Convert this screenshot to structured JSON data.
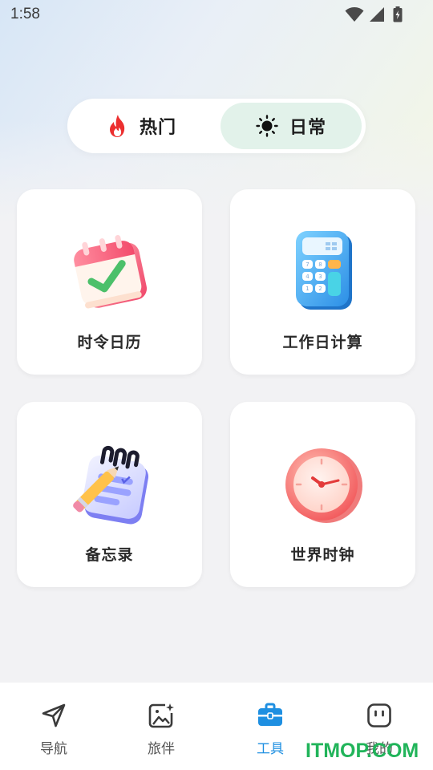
{
  "status": {
    "time": "1:58"
  },
  "segment": {
    "tabs": [
      {
        "label": "热门",
        "icon": "flame-icon",
        "selected": false
      },
      {
        "label": "日常",
        "icon": "sun-icon",
        "selected": true
      }
    ]
  },
  "tools": [
    {
      "label": "时令日历",
      "icon": "calendar-icon"
    },
    {
      "label": "工作日计算",
      "icon": "calculator-icon"
    },
    {
      "label": "备忘录",
      "icon": "notepad-icon"
    },
    {
      "label": "世界时钟",
      "icon": "clock-icon"
    }
  ],
  "nav": {
    "items": [
      {
        "label": "导航",
        "icon": "navigation-arrow-icon",
        "active": false
      },
      {
        "label": "旅伴",
        "icon": "photo-icon",
        "active": false
      },
      {
        "label": "工具",
        "icon": "toolbox-icon",
        "active": true
      },
      {
        "label": "我的",
        "icon": "profile-face-icon",
        "active": false
      }
    ]
  },
  "watermark": "ITMOP.COM",
  "colors": {
    "accent": "#1e8fe1",
    "selected_tab_bg": "#e2f2ea",
    "watermark": "#21b45a"
  }
}
